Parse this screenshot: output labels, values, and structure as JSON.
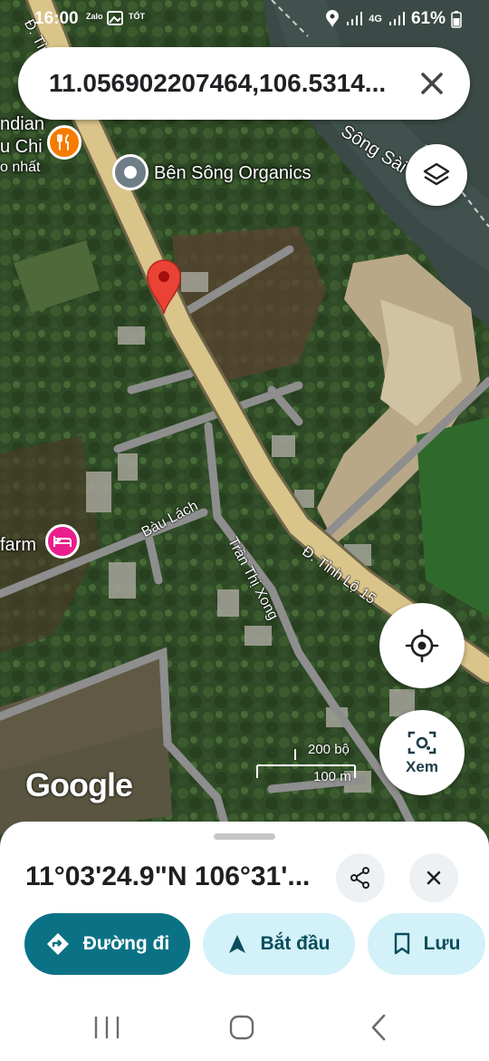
{
  "status_bar": {
    "time": "16:00",
    "app_icons": [
      "Zalo",
      "TỐT"
    ],
    "network": "4G",
    "battery": "61%"
  },
  "search": {
    "query": "11.056902207464,106.5314..."
  },
  "map": {
    "labels": {
      "restaurant_partial_1": "ndian",
      "restaurant_partial_2": "u Chi",
      "restaurant_partial_3": "o nhất",
      "poi_name": "Bên Sông Organics",
      "river_name": "Sông Sài G",
      "road_bau_lach": "Bàu Lách",
      "road_tran_thi_xong": "Trần Thị Xong",
      "road_tinh_lo": "Đ. Tỉnh Lộ 15",
      "road_top": "Đ. Tỉn",
      "farm_partial": "farm"
    },
    "google_logo": "Google",
    "scale": {
      "imperial": "200 bộ",
      "metric": "100 m"
    },
    "colors": {
      "main_road": "#d9c48a",
      "minor_road": "#8e8e8e",
      "pin": "#ea4335",
      "restaurant_poi": "#f57c00",
      "hotel_poi": "#e91e8c"
    }
  },
  "controls": {
    "layers_icon": "layers-icon",
    "locate_icon": "my-location-icon",
    "lens_label": "Xem"
  },
  "sheet": {
    "coordinates": "11°03'24.9\"N 106°31'...",
    "actions": {
      "directions": "Đường đi",
      "start": "Bắt đầu",
      "save": "Lưu"
    }
  }
}
